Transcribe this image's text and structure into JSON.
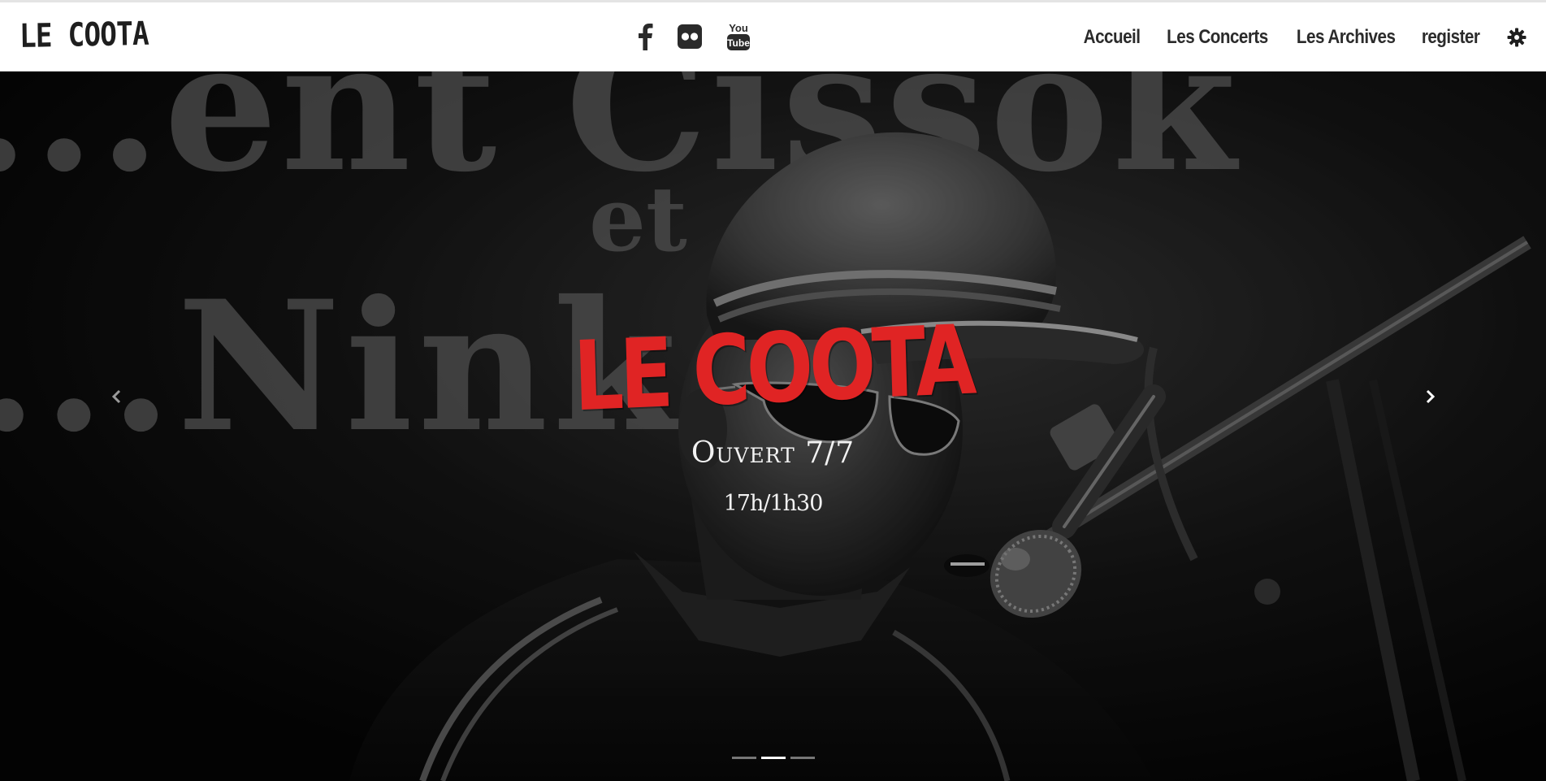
{
  "brand": {
    "text": "LE COOTA"
  },
  "social": [
    {
      "name": "facebook-icon"
    },
    {
      "name": "flickr-icon"
    },
    {
      "name": "youtube-icon",
      "line1": "You",
      "line2": "Tube"
    }
  ],
  "nav": {
    "items": [
      {
        "label": "Accueil"
      },
      {
        "label": "Les Concerts"
      },
      {
        "label": "Les Archives"
      },
      {
        "label": "register"
      }
    ],
    "settings_icon": "gear-icon"
  },
  "hero": {
    "title": "LE COOTA",
    "subtitle_1": "Ouvert 7/7",
    "subtitle_2": "17h/1h30",
    "background_text": {
      "line1": "...ent Cissok",
      "line2": "et",
      "line3": "...Nink..."
    },
    "slide_count": 3,
    "active_slide": 2
  },
  "colors": {
    "accent_red": "#e02424",
    "nav_text": "#2b2b2b",
    "hero_text": "#f2f2f2"
  }
}
